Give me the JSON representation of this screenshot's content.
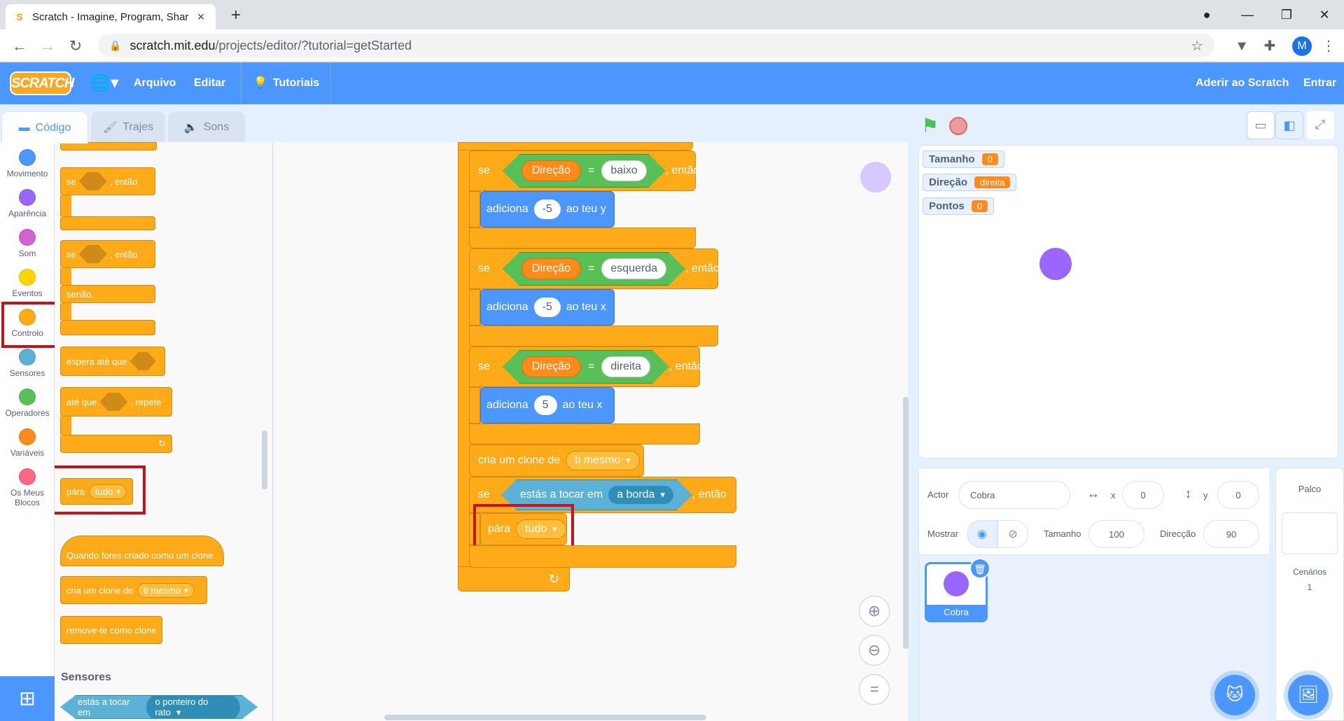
{
  "browser": {
    "tab_title": "Scratch - Imagine, Program, Shar",
    "url_host": "scratch.mit.edu",
    "url_path": "/projects/editor/?tutorial=getStarted",
    "profile_letter": "M"
  },
  "menu": {
    "logo": "SCRATCH",
    "file": "Arquivo",
    "edit": "Editar",
    "tutorials": "Tutoriais",
    "join": "Aderir ao Scratch",
    "signin": "Entrar"
  },
  "tabs": {
    "code": "Código",
    "costumes": "Trajes",
    "sounds": "Sons"
  },
  "categories": [
    {
      "label": "Movimento",
      "color": "#4c97ff"
    },
    {
      "label": "Aparência",
      "color": "#9966ff"
    },
    {
      "label": "Som",
      "color": "#cf63cf"
    },
    {
      "label": "Eventos",
      "color": "#ffd500"
    },
    {
      "label": "Controlo",
      "color": "#ffab19"
    },
    {
      "label": "Sensores",
      "color": "#5cb1d6"
    },
    {
      "label": "Operadores",
      "color": "#59c059"
    },
    {
      "label": "Variáveis",
      "color": "#ff8c1a"
    },
    {
      "label": "Os Meus Blocos",
      "color": "#ff6680"
    }
  ],
  "palette": {
    "if_label": "se",
    "then_label": ", então",
    "else_label": "senão,",
    "wait_until": "espera até que",
    "repeat_until_a": "até que",
    "repeat_until_b": ", repete",
    "stop": "pára",
    "stop_all": "tudo",
    "when_clone": "Quando fores criado como um clone",
    "create_clone": "cria um clone de",
    "myself": "ti mesmo",
    "delete_clone": "remove-te como clone",
    "sensing_heading": "Sensores",
    "touching": "estás a tocar em",
    "mouse_pointer": "o ponteiro do rato"
  },
  "script": {
    "if": "se",
    "then": ", então",
    "direction_var": "Direção",
    "equals": "=",
    "down": "baixo",
    "left": "esquerda",
    "right": "direita",
    "change_by": "adiciona",
    "to_y": "ao teu y",
    "to_x": "ao teu x",
    "val_neg5": "-5",
    "val_neg5_b": "-5",
    "val_5": "5",
    "create_clone": "cria um clone de",
    "myself": "ti mesmo",
    "touching": "estás a tocar em",
    "edge": "a borda",
    "stop": "pára",
    "stop_all": "tudo"
  },
  "zoom": {
    "reset": "="
  },
  "stage": {
    "monitors": [
      {
        "name": "Tamanho",
        "value": "0"
      },
      {
        "name": "Direção",
        "value": "direita"
      },
      {
        "name": "Pontos",
        "value": "0"
      }
    ],
    "sprite_color": "#9966ff"
  },
  "sprite_info": {
    "actor_label": "Actor",
    "actor_name": "Cobra",
    "x_label": "x",
    "x_value": "0",
    "y_label": "y",
    "y_value": "0",
    "show_label": "Mostrar",
    "size_label": "Tamanho",
    "size_value": "100",
    "direction_label": "Direcção",
    "direction_value": "90",
    "sprite_name": "Cobra"
  },
  "stage_pane": {
    "title": "Palco",
    "backdrops_label": "Cenários",
    "backdrops_count": "1"
  }
}
